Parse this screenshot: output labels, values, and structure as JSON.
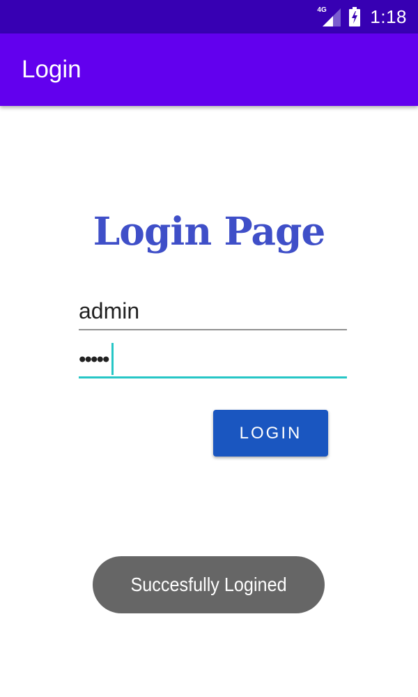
{
  "status_bar": {
    "network_type": "4G",
    "time": "1:18",
    "icons": [
      "signal-icon",
      "battery-charging-icon"
    ],
    "bar_color": "#3700b3"
  },
  "app_bar": {
    "title": "Login",
    "bar_color": "#6200ee"
  },
  "login_form": {
    "heading": "Login Page",
    "heading_color": "#3f4fc8",
    "username_value": "admin",
    "password_value": "•••••",
    "login_button_label": "LOGIN",
    "button_color": "#1a56c0",
    "focus_color": "#26c6c6"
  },
  "toast": {
    "message": "Succesfully Logined"
  }
}
